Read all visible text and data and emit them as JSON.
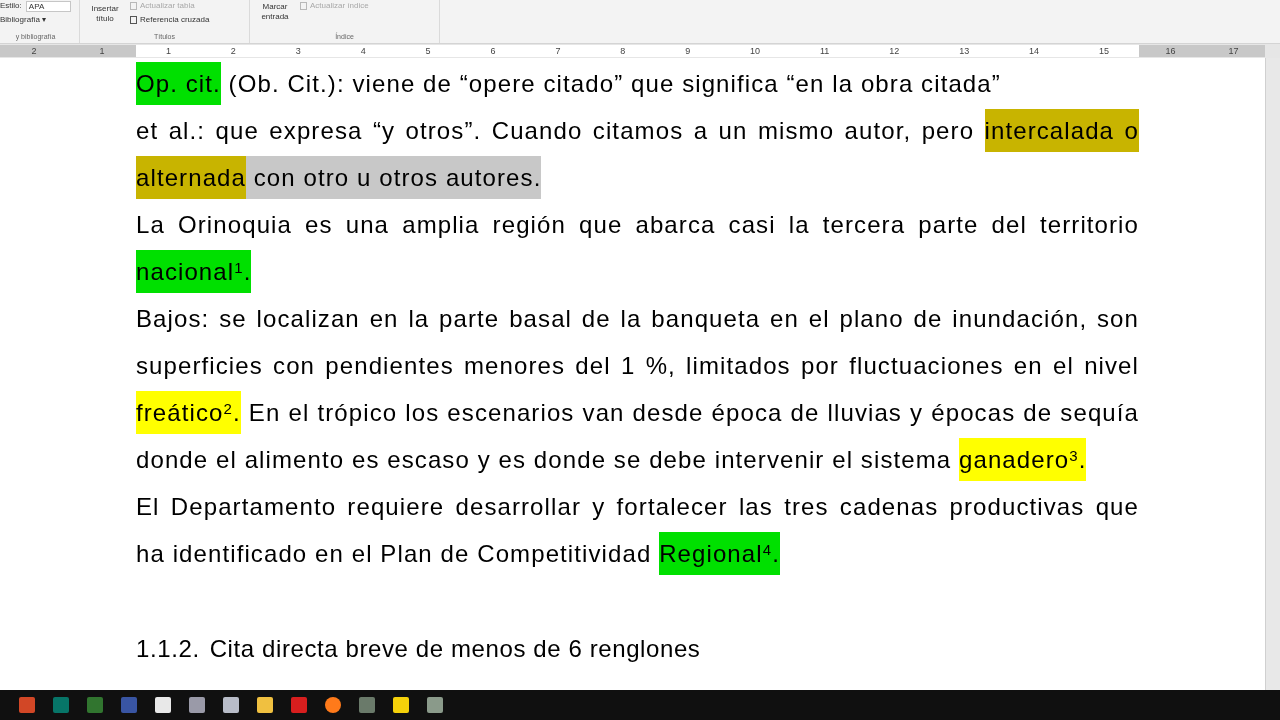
{
  "ribbon": {
    "groups": [
      {
        "label": "y bibliografía",
        "items": [
          {
            "kind": "select",
            "label": "Estilo:",
            "value": "APA"
          },
          {
            "kind": "menu",
            "label": "Bibliografía",
            "caret": "▾"
          }
        ]
      },
      {
        "label": "Títulos",
        "items": [
          {
            "kind": "large",
            "label": "Insertar título",
            "disabled": false
          },
          {
            "kind": "small",
            "label": "Actualizar tabla",
            "disabled": true
          },
          {
            "kind": "small",
            "label": "Referencia cruzada",
            "disabled": false
          }
        ]
      },
      {
        "label": "Índice",
        "items": [
          {
            "kind": "large",
            "label": "Marcar entrada",
            "disabled": false
          },
          {
            "kind": "small",
            "label": "Actualizar índice",
            "disabled": true
          }
        ]
      }
    ]
  },
  "ruler": [
    "2",
    "1",
    "1",
    "2",
    "3",
    "4",
    "5",
    "6",
    "7",
    "8",
    "9",
    "10",
    "11",
    "12",
    "13",
    "14",
    "15",
    "16",
    "17"
  ],
  "document": {
    "paragraphs": [
      {
        "kind": "body",
        "segments": [
          {
            "text": "Op. cit.",
            "color": "#00e000"
          },
          {
            "text": " (Ob. Cit.): viene de “opere citado” que significa “en la obra citada”"
          }
        ]
      },
      {
        "kind": "body",
        "segments": [
          {
            "text": "et al.: que expresa “y otros”. Cuando citamos a un mismo autor, pero "
          },
          {
            "text": "intercalada o alternada",
            "color": "#c8b400"
          },
          {
            "text": " con otro u otros autores.",
            "color": "#c8c8c8"
          }
        ]
      },
      {
        "kind": "body",
        "segments": [
          {
            "text": "La Orinoquia es una amplia región que abarca casi la tercera parte del territorio "
          },
          {
            "text": "nacional$^{1}$.",
            "color": "#00e000"
          }
        ]
      },
      {
        "kind": "body",
        "segments": [
          {
            "text": "Bajos: se localizan en la parte basal de la banqueta en el plano de inundación, son superficies con pendientes menores del 1 %, limitados por fluctuaciones en el nivel "
          },
          {
            "text": "freático$^{2}$.",
            "color": "#ffff00"
          },
          {
            "text": " En el trópico los escenarios van desde época de lluvias y épocas de sequía donde el alimento es escaso y es donde se debe intervenir el sistema "
          },
          {
            "text": "ganadero$^{3}$.",
            "color": "#ffff00"
          }
        ]
      },
      {
        "kind": "body",
        "segments": [
          {
            "text": "El Departamento requiere desarrollar y fortalecer las tres cadenas productivas que ha identificado en el Plan de Competitividad "
          },
          {
            "text": "Regional$^{4}$.",
            "color": "#00e000"
          }
        ]
      },
      {
        "kind": "heading",
        "number": "1.1.2.",
        "segments": [
          {
            "text": "Cita directa breve de menos de 6 renglones"
          }
        ]
      }
    ]
  },
  "taskbar": [
    {
      "kind": "powerpoint"
    },
    {
      "kind": "publisher"
    },
    {
      "kind": "project"
    },
    {
      "kind": "visio"
    },
    {
      "kind": "calculator"
    },
    {
      "kind": "paint"
    },
    {
      "kind": "cloud"
    },
    {
      "kind": "folder"
    },
    {
      "kind": "pdf"
    },
    {
      "kind": "browser"
    },
    {
      "kind": "app"
    },
    {
      "kind": "notes"
    },
    {
      "kind": "app2"
    }
  ]
}
